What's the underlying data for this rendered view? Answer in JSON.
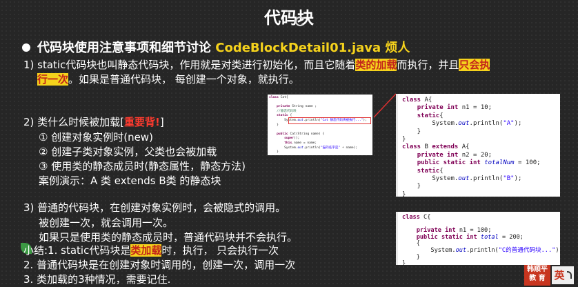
{
  "slide": {
    "title": "代码块",
    "heading_prefix": "代码块使用注意事项和细节讨论 ",
    "heading_file": "CodeBlockDetail01.java 烦人",
    "p1": {
      "a": "1) static代码块也叫静态代码块，作用就是对类进行初始化，而且它随着",
      "b": "类的加载",
      "c": "而执行，并且",
      "d": "只会执",
      "e": "行一次",
      "f": "。如果是普通代码块， 每创建一个对象，就执行。"
    },
    "p2": {
      "head_a": "2) 类什么时候被加载[",
      "head_b": "重要背!",
      "head_c": "]",
      "items": [
        "① 创建对象实例时(new)",
        "② 创建子类对象实例，父类也会被加载",
        "③ 使用类的静态成员时(静态属性，静态方法)"
      ],
      "demo": "案例演示：A 类 extends  B类 的静态块"
    },
    "p3": {
      "lines": [
        "3) 普通的代码块，在创建对象实例时，会被隐式的调用。",
        "被创建一次，就会调用一次。",
        "如果只是使用类的静态成员时，普通代码块并不会执行。"
      ]
    },
    "summary": {
      "l1_a": "小结:1. static代码块是",
      "l1_b": "类加载",
      "l1_c": "时，执行， 只会执行一次",
      "l2": "2. 普通代码块是在创建对象时调用的，创建一次，调用一次",
      "l3": "3. 类加载的3种情况，需要记住."
    },
    "logo": {
      "line1": "韩顺平",
      "line2": "教 育",
      "badge": "英"
    },
    "colors": {
      "background": "#262626",
      "highlight": "#f5d21c",
      "accent_red": "#ff3b2f",
      "heading_yellow": "#f5d21c"
    }
  },
  "code_small": {
    "lines": [
      "class Cat{",
      "",
      "    private String name ;",
      "    //静态代码块",
      "    static {",
      "        System.out.println(\"Cat 静态代码块被执行...\");",
      "    }",
      "",
      "    public Cat(String name) {",
      "        super();",
      "        this.name = name;",
      "        System.out.println(\"猫的名字是\" + name);",
      "    }"
    ]
  },
  "code_ab": {
    "lines": [
      "class A{",
      "    private int n1 = 10;",
      "    static{",
      "        System.out.println(\"A\");",
      "    }",
      "}",
      "class B extends A{",
      "    private int n2 = 20;",
      "    public static int totalNum = 100;",
      "    static{",
      "        System.out.println(\"B\");",
      "    }",
      "}"
    ]
  },
  "code_c": {
    "lines": [
      "class C{",
      "",
      "    private int n1 = 100;",
      "    public static int total = 200;",
      "    {",
      "        System.out.println(\"C的普通代码块...\");",
      "    }",
      "}"
    ]
  }
}
